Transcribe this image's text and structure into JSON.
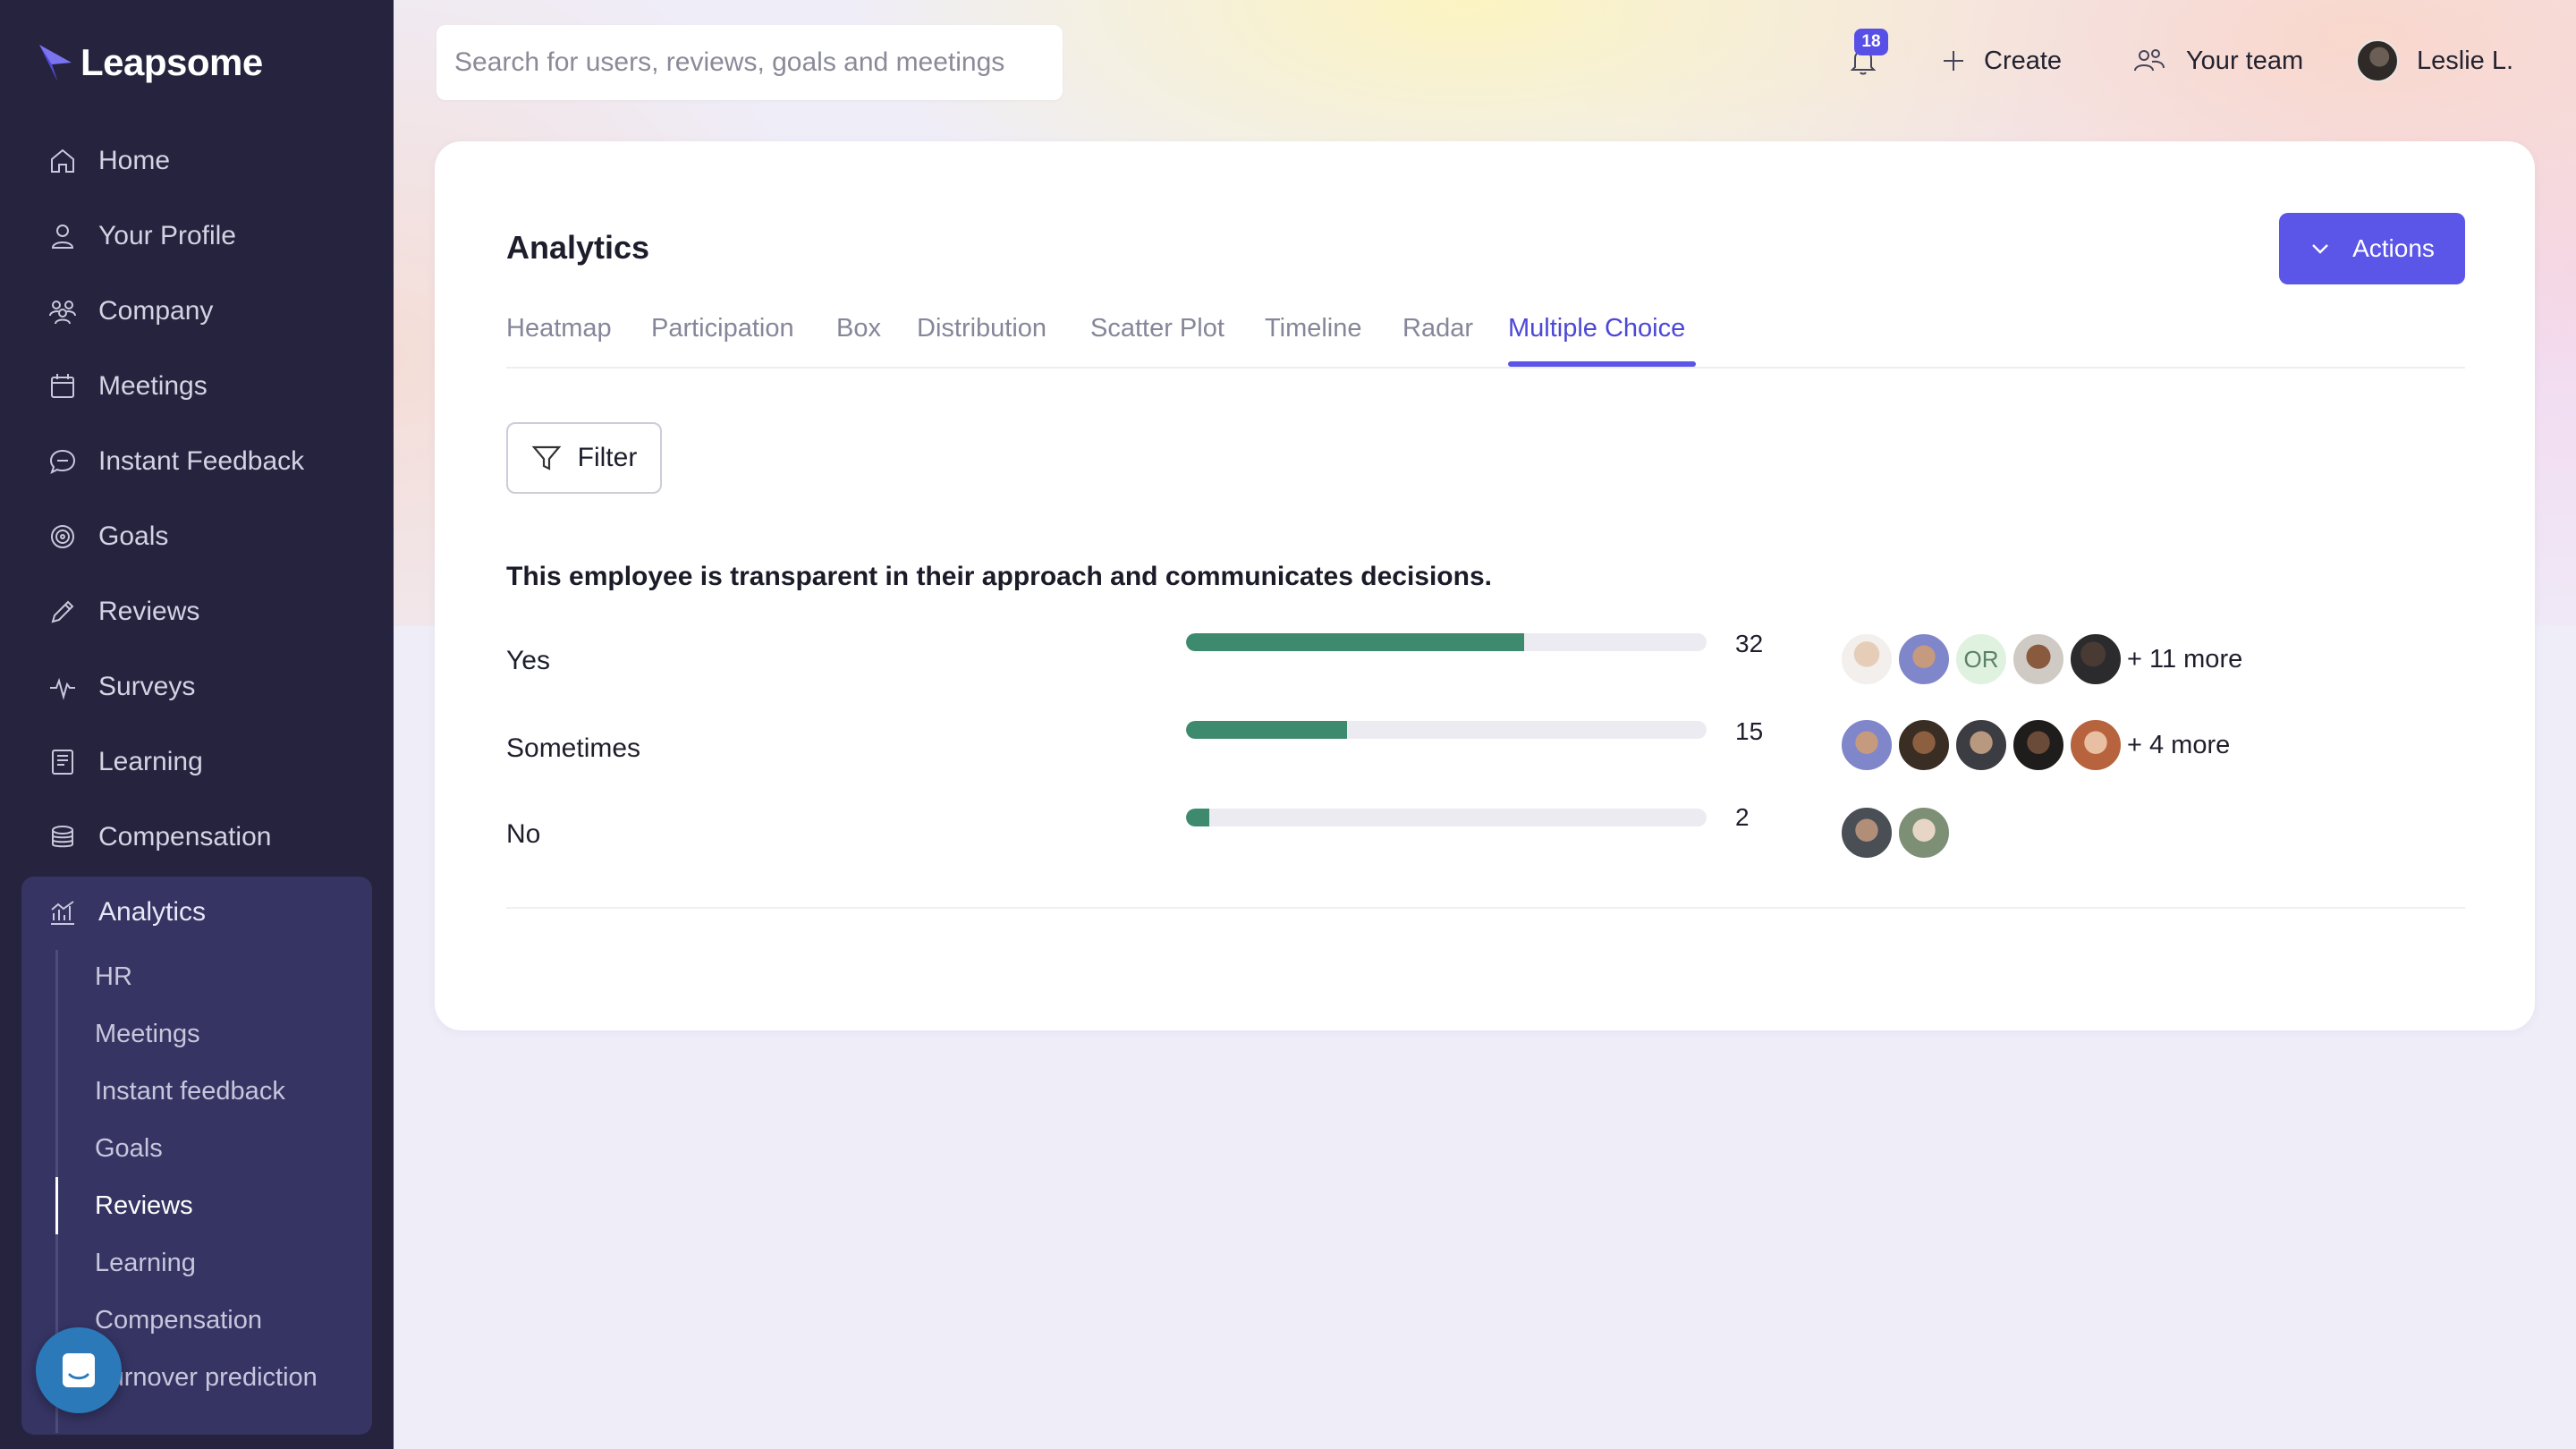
{
  "app": {
    "logo_text": "Leapsome"
  },
  "sidebar": {
    "items": [
      {
        "label": "Home",
        "icon": "home-icon"
      },
      {
        "label": "Your Profile",
        "icon": "user-icon"
      },
      {
        "label": "Company",
        "icon": "company-icon"
      },
      {
        "label": "Meetings",
        "icon": "calendar-icon"
      },
      {
        "label": "Instant Feedback",
        "icon": "chat-icon"
      },
      {
        "label": "Goals",
        "icon": "target-icon"
      },
      {
        "label": "Reviews",
        "icon": "pencil-icon"
      },
      {
        "label": "Surveys",
        "icon": "pulse-icon"
      },
      {
        "label": "Learning",
        "icon": "book-icon"
      },
      {
        "label": "Compensation",
        "icon": "coins-icon"
      },
      {
        "label": "Analytics",
        "icon": "analytics-icon"
      }
    ],
    "analytics_sub": [
      {
        "label": "HR"
      },
      {
        "label": "Meetings"
      },
      {
        "label": "Instant feedback"
      },
      {
        "label": "Goals"
      },
      {
        "label": "Reviews",
        "active": true
      },
      {
        "label": "Learning"
      },
      {
        "label": "Compensation"
      },
      {
        "label": "Turnover prediction"
      }
    ]
  },
  "header": {
    "search_placeholder": "Search for users, reviews, goals and meetings",
    "notifications_count": "18",
    "create_label": "Create",
    "team_label": "Your team",
    "user_name": "Leslie L."
  },
  "page": {
    "title": "Analytics",
    "actions_label": "Actions",
    "tabs": [
      {
        "label": "Heatmap"
      },
      {
        "label": "Participation"
      },
      {
        "label": "Box"
      },
      {
        "label": "Distribution"
      },
      {
        "label": "Scatter Plot"
      },
      {
        "label": "Timeline"
      },
      {
        "label": "Radar"
      },
      {
        "label": "Multiple Choice",
        "active": true
      }
    ],
    "filter_label": "Filter",
    "question": "This employee is transparent in their approach and communicates decisions.",
    "options": [
      {
        "label": "Yes",
        "count": "32",
        "fill": 0.65,
        "more": "+ 11 more"
      },
      {
        "label": "Sometimes",
        "count": "15",
        "fill": 0.31,
        "more": "+ 4 more"
      },
      {
        "label": "No",
        "count": "2",
        "fill": 0.045,
        "more": ""
      }
    ],
    "initials_avatar": "OR"
  },
  "colors": {
    "sidebar_bg": "#25233e",
    "accent": "#5b55e8",
    "bar_fill": "#3d8a6e"
  }
}
